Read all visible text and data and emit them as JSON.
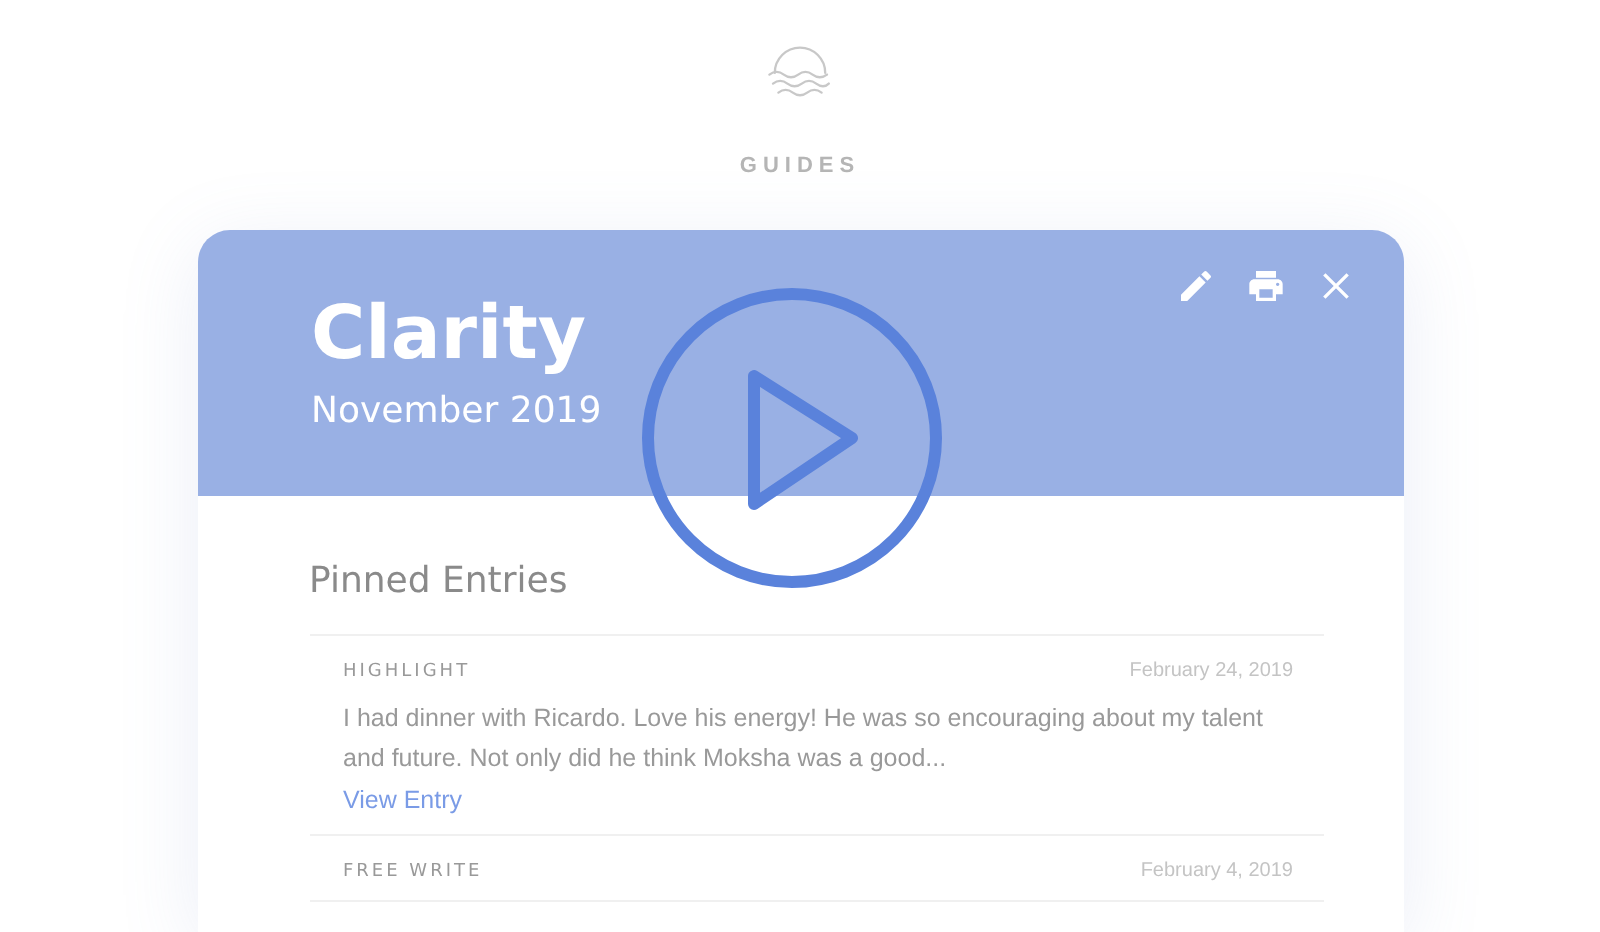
{
  "section_title": "GUIDES",
  "guide": {
    "title": "Clarity",
    "subtitle": "November 2019"
  },
  "pinned": {
    "heading": "Pinned Entries",
    "entries": [
      {
        "kind": "HIGHLIGHT",
        "date": "February 24, 2019",
        "excerpt": "I had dinner with Ricardo. Love his energy! He was so encouraging about my talent and future. Not only did he think Moksha was a good...",
        "link": "View Entry"
      },
      {
        "kind": "FREE WRITE",
        "date": "February 4, 2019"
      }
    ]
  }
}
